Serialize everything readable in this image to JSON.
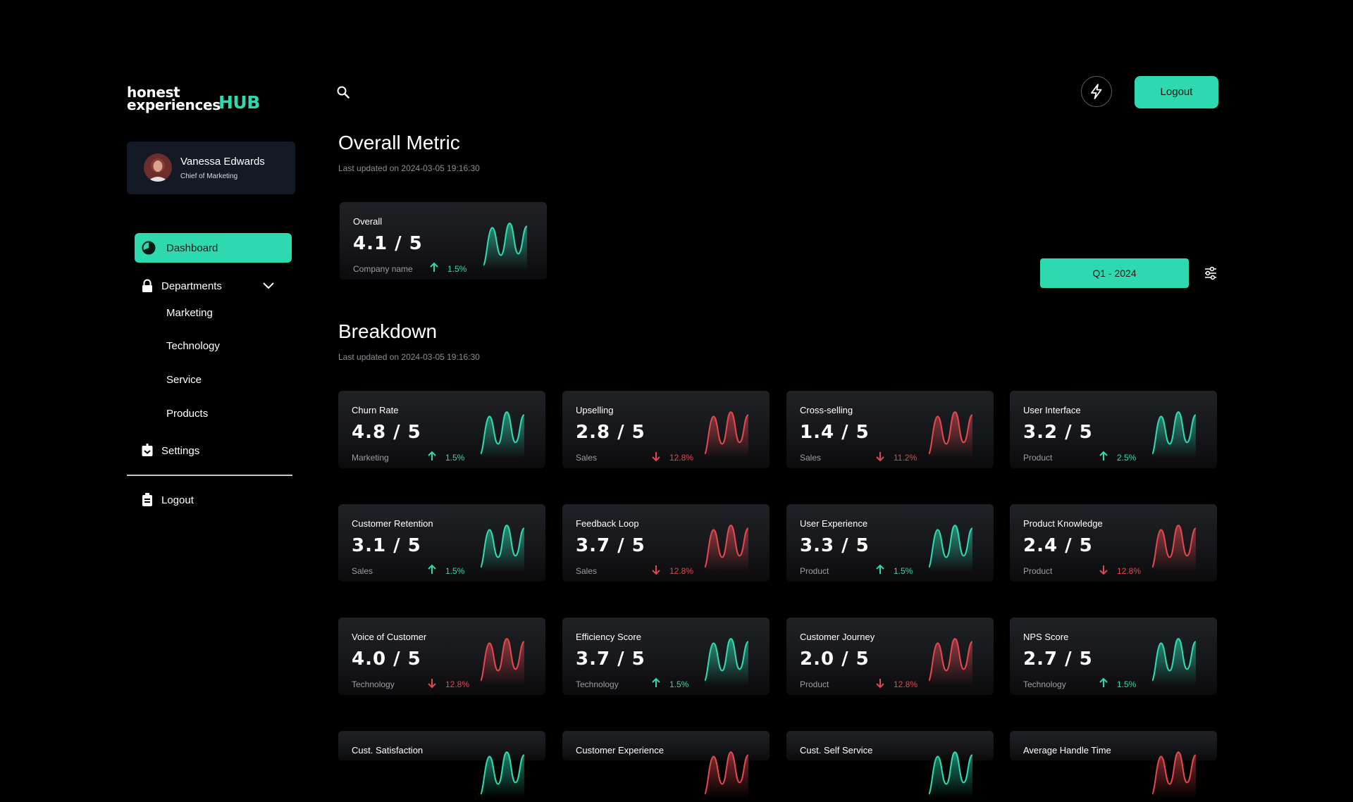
{
  "brand": {
    "line1": "honest",
    "line2": "experiences",
    "hub": "HUB"
  },
  "user": {
    "name": "Vanessa Edwards",
    "role": "Chief of Marketing"
  },
  "nav": {
    "dashboard": "Dashboard",
    "departments": "Departments",
    "departments_items": [
      "Marketing",
      "Technology",
      "Service",
      "Products"
    ],
    "settings": "Settings",
    "logout": "Logout"
  },
  "header": {
    "logout_label": "Logout"
  },
  "overall": {
    "heading": "Overall Metric",
    "updated": "Last updated on 2024-03-05 19:16:30",
    "card": {
      "title": "Overall",
      "score": "4.1 / 5",
      "dept": "Company name",
      "change": "1.5%",
      "trend": "up"
    }
  },
  "period": {
    "label": "Q1 - 2024"
  },
  "breakdown": {
    "heading": "Breakdown",
    "updated": "Last updated on 2024-03-05 19:16:30",
    "cards": [
      {
        "title": "Churn Rate",
        "score": "4.8 / 5",
        "dept": "Marketing",
        "change": "1.5%",
        "trend": "up"
      },
      {
        "title": "Upselling",
        "score": "2.8 / 5",
        "dept": "Sales",
        "change": "12.8%",
        "trend": "down"
      },
      {
        "title": "Cross-selling",
        "score": "1.4 / 5",
        "dept": "Sales",
        "change": "11.2%",
        "trend": "down"
      },
      {
        "title": "User Interface",
        "score": "3.2 / 5",
        "dept": "Product",
        "change": "2.5%",
        "trend": "up"
      },
      {
        "title": "Customer Retention",
        "score": "3.1 / 5",
        "dept": "Sales",
        "change": "1.5%",
        "trend": "up"
      },
      {
        "title": "Feedback Loop",
        "score": "3.7 / 5",
        "dept": "Sales",
        "change": "12.8%",
        "trend": "down"
      },
      {
        "title": "User Experience",
        "score": "3.3 / 5",
        "dept": "Product",
        "change": "1.5%",
        "trend": "up"
      },
      {
        "title": "Product Knowledge",
        "score": "2.4 / 5",
        "dept": "Product",
        "change": "12.8%",
        "trend": "down"
      },
      {
        "title": "Voice of Customer",
        "score": "4.0 / 5",
        "dept": "Technology",
        "change": "12.8%",
        "trend": "down"
      },
      {
        "title": "Efficiency Score",
        "score": "3.7 / 5",
        "dept": "Technology",
        "change": "1.5%",
        "trend": "up"
      },
      {
        "title": "Customer Journey",
        "score": "2.0 / 5",
        "dept": "Product",
        "change": "12.8%",
        "trend": "down"
      },
      {
        "title": "NPS Score",
        "score": "2.7 / 5",
        "dept": "Technology",
        "change": "1.5%",
        "trend": "up"
      },
      {
        "title": "Cust. Satisfaction",
        "trend": "up"
      },
      {
        "title": "Customer Experience",
        "trend": "down"
      },
      {
        "title": "Cust. Self Service",
        "trend": "up"
      },
      {
        "title": "Average Handle Time",
        "trend": "down"
      }
    ]
  },
  "colors": {
    "accent": "#2fd9b0",
    "up": "#2fd9b0",
    "down": "#e0484f",
    "background": "#000000"
  },
  "icons": {
    "search": "search-icon",
    "bolt": "bolt-icon",
    "filter": "sliders-icon",
    "dashboard": "pie-chart-icon",
    "departments": "lock-icon",
    "settings": "settings-icon",
    "logout": "logout-icon",
    "chevron": "chevron-down-icon",
    "up": "arrow-up-icon",
    "down": "arrow-down-icon"
  }
}
